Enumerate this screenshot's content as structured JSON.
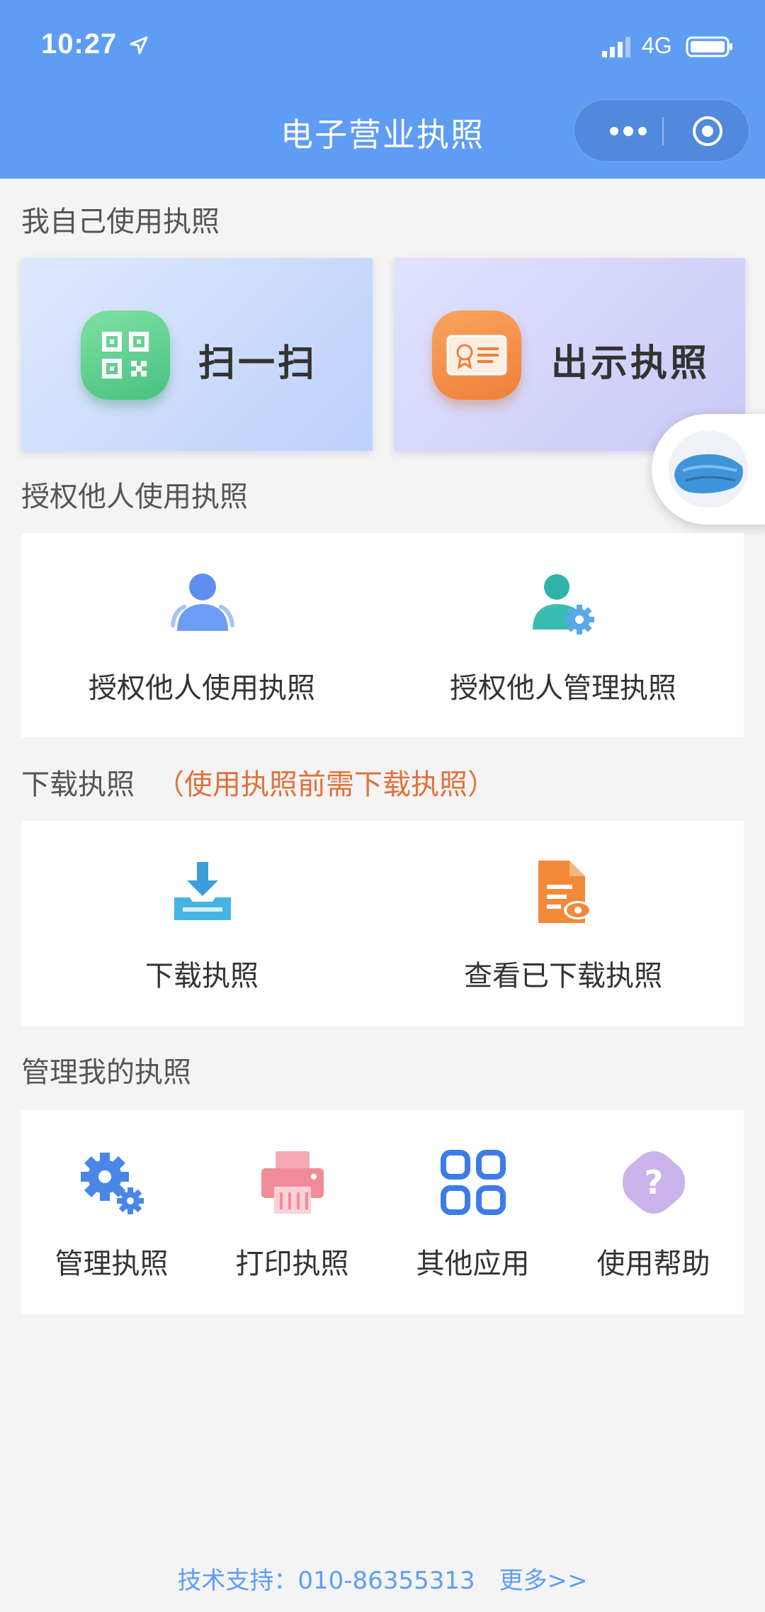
{
  "status_bar": {
    "time": "10:27",
    "network": "4G"
  },
  "header": {
    "title": "电子营业执照"
  },
  "section_self": {
    "title": "我自己使用执照",
    "scan_label": "扫一扫",
    "show_label": "出示执照"
  },
  "section_auth": {
    "title": "授权他人使用执照",
    "items": [
      {
        "label": "授权他人使用执照"
      },
      {
        "label": "授权他人管理执照"
      }
    ]
  },
  "section_download": {
    "title": "下载执照",
    "note": "（使用执照前需下载执照）",
    "items": [
      {
        "label": "下载执照"
      },
      {
        "label": "查看已下载执照"
      }
    ]
  },
  "section_manage": {
    "title": "管理我的执照",
    "items": [
      {
        "label": "管理执照"
      },
      {
        "label": "打印执照"
      },
      {
        "label": "其他应用"
      },
      {
        "label": "使用帮助"
      }
    ]
  },
  "footer": {
    "support_label": "技术支持：",
    "phone": "010-86355313",
    "more": "更多>>"
  },
  "colors": {
    "header_bg": "#5f9df4",
    "note_orange": "#e0713b",
    "footer_blue": "#5f9df4"
  }
}
